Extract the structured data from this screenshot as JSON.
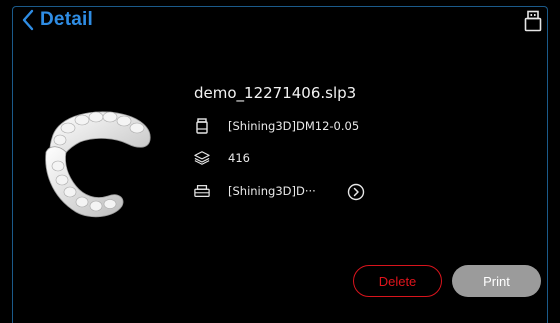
{
  "header": {
    "title": "Detail",
    "back_icon": "chevron-left-icon",
    "usb_icon": "usb-drive-icon",
    "accent_color": "#2f8de4"
  },
  "file": {
    "name": "demo_12271406.slp3",
    "thumbnail": "dental-model-thumbnail"
  },
  "details": {
    "material": {
      "icon": "resin-bottle-icon",
      "value": "[Shining3D]DM12-0.05"
    },
    "layers": {
      "icon": "layers-icon",
      "value": "416"
    },
    "printer": {
      "icon": "printer-icon",
      "value": "[Shining3D]D···",
      "more_icon": "chevron-right-circle-icon"
    }
  },
  "actions": {
    "delete_label": "Delete",
    "print_label": "Print",
    "delete_color": "#d8141c",
    "print_color": "#9b9b9b"
  }
}
